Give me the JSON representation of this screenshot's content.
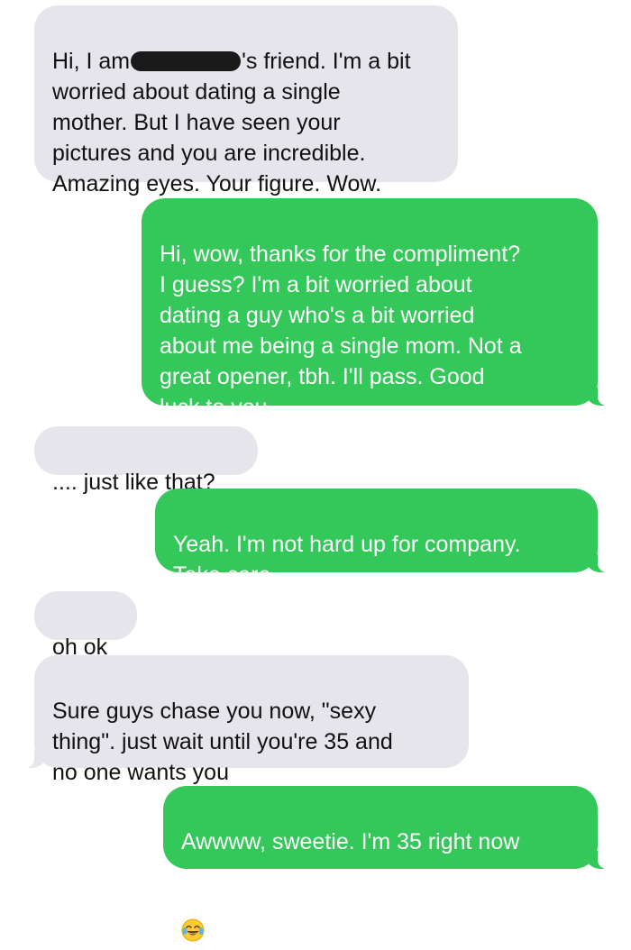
{
  "messages": [
    {
      "direction": "incoming",
      "text_before_redaction": "Hi, I am",
      "text_after_redaction": "'s friend. I'm a bit\nworried about dating a single\nmother. But I have seen your\npictures and you are incredible.\nAmazing eyes. Your figure. Wow."
    },
    {
      "direction": "outgoing",
      "text": "Hi, wow, thanks for the compliment?\nI guess? I'm a bit worried about\ndating a guy who's a bit worried\nabout me being a single mom. Not a\ngreat opener, tbh. I'll pass. Good\nluck to you."
    },
    {
      "direction": "incoming",
      "text": ".... just like that?"
    },
    {
      "direction": "outgoing",
      "text": "Yeah. I'm not hard up for company.\nTake care."
    },
    {
      "direction": "incoming",
      "text": "oh ok"
    },
    {
      "direction": "incoming",
      "text": "Sure guys chase you now, \"sexy\nthing\". just wait until you're 35 and\nno one wants you"
    },
    {
      "direction": "outgoing",
      "text": "Awwww, sweetie. I'm 35 right now",
      "emoji": "face-with-tears-of-joy-icon"
    }
  ],
  "colors": {
    "incoming_bubble": "#e6e5eb",
    "outgoing_bubble": "#34c759",
    "incoming_text": "#111111",
    "outgoing_text": "#ffffff"
  }
}
